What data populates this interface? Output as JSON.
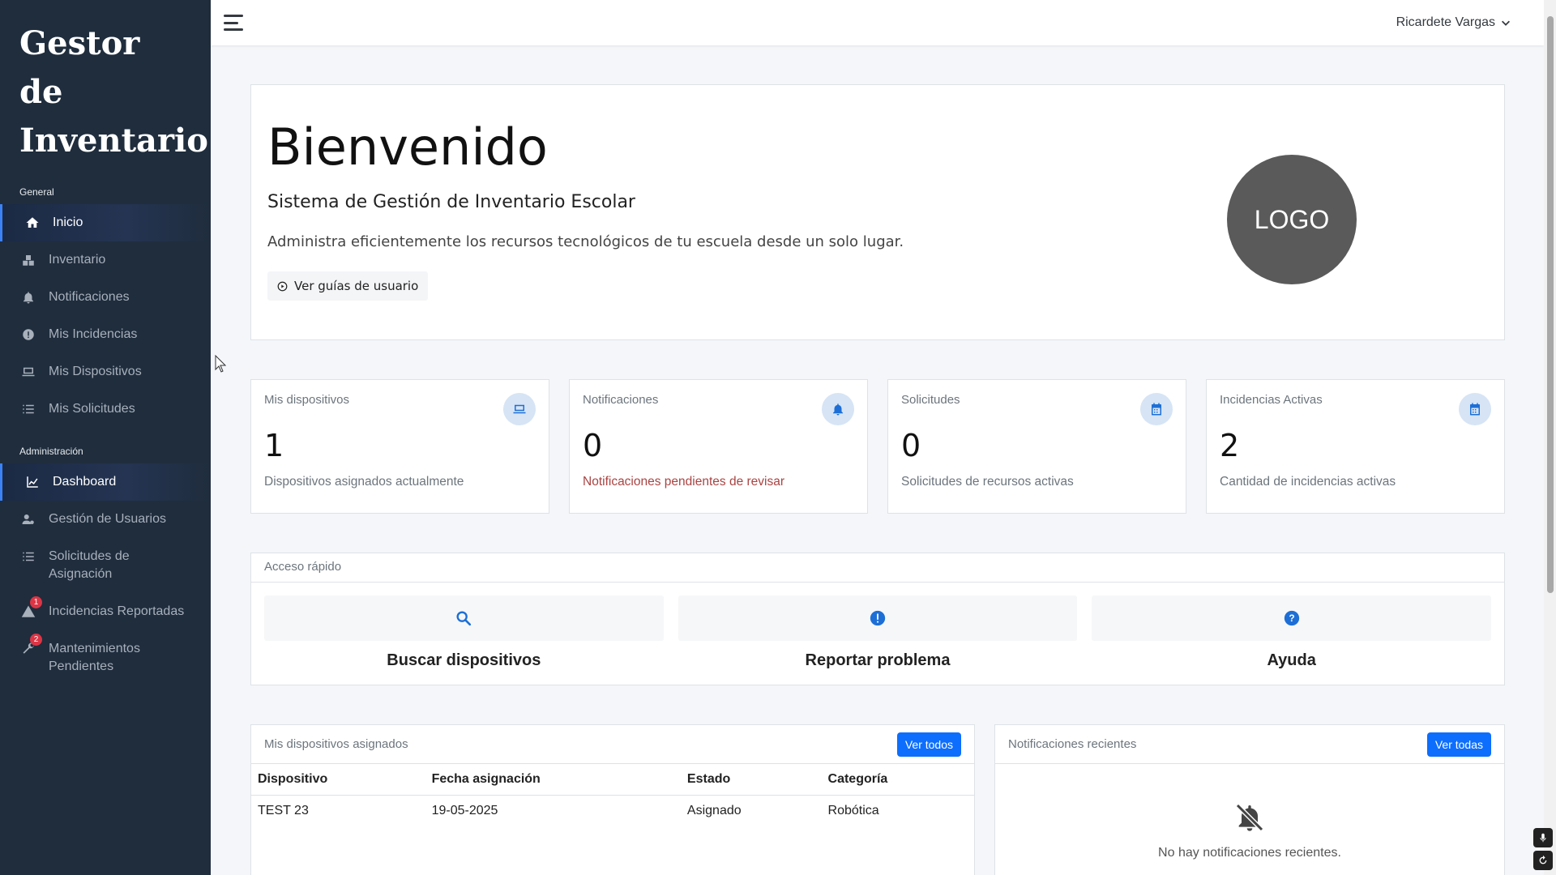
{
  "brand": {
    "line1": "Gestor de",
    "line2": "Inventario"
  },
  "sidebar": {
    "general_label": "General",
    "general_items": [
      {
        "label": "Inicio",
        "icon": "home-icon"
      },
      {
        "label": "Inventario",
        "icon": "boxes-icon"
      },
      {
        "label": "Notificaciones",
        "icon": "bell-icon"
      },
      {
        "label": "Mis Incidencias",
        "icon": "info-icon"
      },
      {
        "label": "Mis Dispositivos",
        "icon": "laptop-icon"
      },
      {
        "label": "Mis Solicitudes",
        "icon": "list-icon"
      }
    ],
    "admin_label": "Administración",
    "admin_items": [
      {
        "label": "Dashboard",
        "icon": "chart-line-icon"
      },
      {
        "label": "Gestión de Usuarios",
        "icon": "user-gear-icon"
      },
      {
        "label": "Solicitudes de Asignación",
        "icon": "list-check-icon"
      },
      {
        "label": "Incidencias Reportadas",
        "icon": "warning-icon",
        "badge": "1"
      },
      {
        "label": "Mantenimientos Pendientes",
        "icon": "wrench-icon",
        "badge": "2"
      }
    ]
  },
  "topbar": {
    "user": "Ricardete Vargas"
  },
  "hero": {
    "title": "Bienvenido",
    "subtitle": "Sistema de Gestión de Inventario Escolar",
    "description": "Administra eficientemente los recursos tecnológicos de tu escuela desde un solo lugar.",
    "guide_button": "Ver guías de usuario",
    "logo_text": "LOGO"
  },
  "stats": [
    {
      "label": "Mis dispositivos",
      "value": "1",
      "sub": "Dispositivos asignados actualmente",
      "icon": "laptop-icon"
    },
    {
      "label": "Notificaciones",
      "value": "0",
      "sub": "Notificaciones pendientes de revisar",
      "icon": "bell-icon"
    },
    {
      "label": "Solicitudes",
      "value": "0",
      "sub": "Solicitudes de recursos activas",
      "icon": "calendar-icon"
    },
    {
      "label": "Incidencias Activas",
      "value": "2",
      "sub": "Cantidad de incidencias activas",
      "icon": "calendar-icon"
    }
  ],
  "quick_access": {
    "title": "Acceso rápido",
    "items": [
      {
        "label": "Buscar dispositivos",
        "icon": "search-icon"
      },
      {
        "label": "Reportar problema",
        "icon": "exclamation-icon"
      },
      {
        "label": "Ayuda",
        "icon": "question-icon"
      }
    ]
  },
  "devices_panel": {
    "title": "Mis dispositivos asignados",
    "button": "Ver todos",
    "columns": [
      "Dispositivo",
      "Fecha asignación",
      "Estado",
      "Categoría"
    ],
    "rows": [
      [
        "TEST 23",
        "19-05-2025",
        "Asignado",
        "Robótica"
      ]
    ]
  },
  "notifications_panel": {
    "title": "Notificaciones recientes",
    "button": "Ver todas",
    "empty": "No hay notificaciones recientes."
  },
  "colors": {
    "sidebar": "#1f2d3d",
    "accent": "#0d6efd",
    "badge": "#dc3545"
  }
}
